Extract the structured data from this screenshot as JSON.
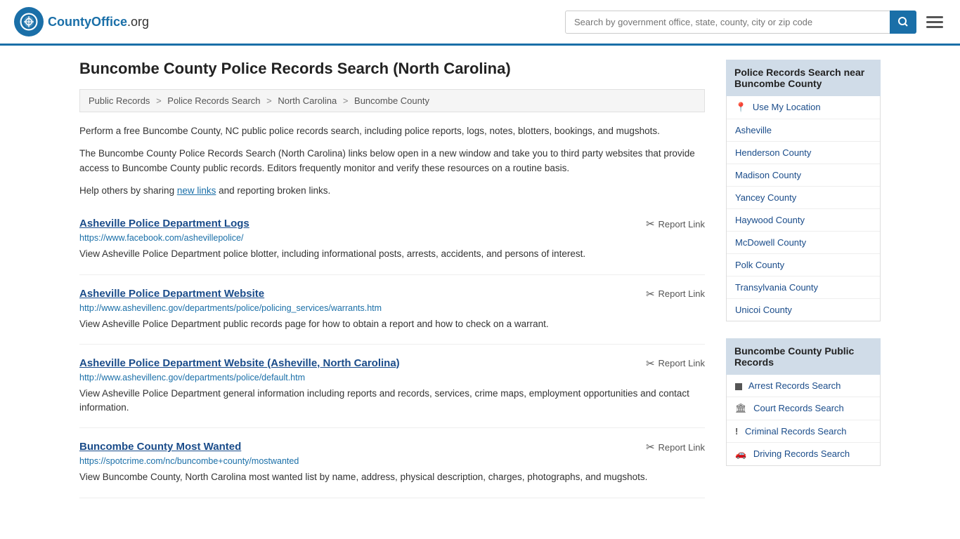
{
  "header": {
    "logo_text": "CountyOffice",
    "logo_suffix": ".org",
    "search_placeholder": "Search by government office, state, county, city or zip code",
    "search_value": ""
  },
  "page": {
    "title": "Buncombe County Police Records Search (North Carolina)"
  },
  "breadcrumb": {
    "items": [
      {
        "label": "Public Records",
        "href": "#"
      },
      {
        "label": "Police Records Search",
        "href": "#"
      },
      {
        "label": "North Carolina",
        "href": "#"
      },
      {
        "label": "Buncombe County",
        "href": "#"
      }
    ]
  },
  "description": {
    "para1": "Perform a free Buncombe County, NC public police records search, including police reports, logs, notes, blotters, bookings, and mugshots.",
    "para2": "The Buncombe County Police Records Search (North Carolina) links below open in a new window and take you to third party websites that provide access to Buncombe County public records. Editors frequently monitor and verify these resources on a routine basis.",
    "para3_prefix": "Help others by sharing ",
    "para3_link": "new links",
    "para3_suffix": " and reporting broken links."
  },
  "results": [
    {
      "title": "Asheville Police Department Logs",
      "url": "https://www.facebook.com/ashevillepolice/",
      "desc": "View Asheville Police Department police blotter, including informational posts, arrests, accidents, and persons of interest.",
      "report_label": "Report Link"
    },
    {
      "title": "Asheville Police Department Website",
      "url": "http://www.ashevillenc.gov/departments/police/policing_services/warrants.htm",
      "desc": "View Asheville Police Department public records page for how to obtain a report and how to check on a warrant.",
      "report_label": "Report Link"
    },
    {
      "title": "Asheville Police Department Website (Asheville, North Carolina)",
      "url": "http://www.ashevillenc.gov/departments/police/default.htm",
      "desc": "View Asheville Police Department general information including reports and records, services, crime maps, employment opportunities and contact information.",
      "report_label": "Report Link"
    },
    {
      "title": "Buncombe County Most Wanted",
      "url": "https://spotcrime.com/nc/buncombe+county/mostwanted",
      "desc": "View Buncombe County, North Carolina most wanted list by name, address, physical description, charges, photographs, and mugshots.",
      "report_label": "Report Link"
    }
  ],
  "sidebar": {
    "nearby_section": {
      "header": "Police Records Search near Buncombe County",
      "items": [
        {
          "label": "Use My Location",
          "icon": "location",
          "href": "#"
        },
        {
          "label": "Asheville",
          "href": "#"
        },
        {
          "label": "Henderson County",
          "href": "#"
        },
        {
          "label": "Madison County",
          "href": "#"
        },
        {
          "label": "Yancey County",
          "href": "#"
        },
        {
          "label": "Haywood County",
          "href": "#"
        },
        {
          "label": "McDowell County",
          "href": "#"
        },
        {
          "label": "Polk County",
          "href": "#"
        },
        {
          "label": "Transylvania County",
          "href": "#"
        },
        {
          "label": "Unicoi County",
          "href": "#"
        }
      ]
    },
    "public_records_section": {
      "header": "Buncombe County Public Records",
      "items": [
        {
          "label": "Arrest Records Search",
          "icon": "square"
        },
        {
          "label": "Court Records Search",
          "icon": "pillar"
        },
        {
          "label": "Criminal Records Search",
          "icon": "exclaim"
        },
        {
          "label": "Driving Records Search",
          "icon": "car"
        }
      ]
    }
  }
}
